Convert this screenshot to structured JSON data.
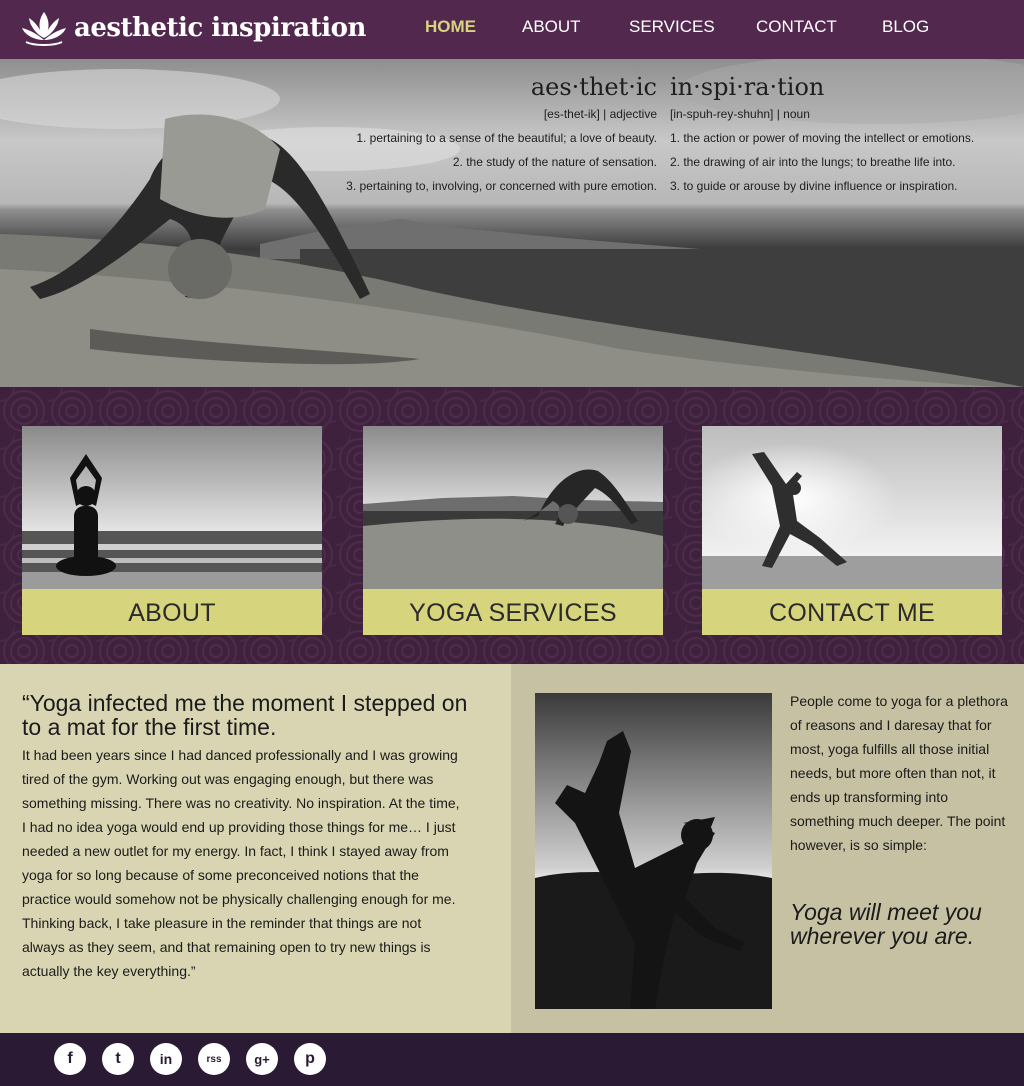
{
  "brand": {
    "name": "aesthetic inspiration",
    "accent": "#d6d47d",
    "purple": "#52284f"
  },
  "nav": [
    {
      "label": "HOME",
      "active": true
    },
    {
      "label": "ABOUT",
      "active": false
    },
    {
      "label": "SERVICES",
      "active": false
    },
    {
      "label": "CONTACT",
      "active": false
    },
    {
      "label": "BLOG",
      "active": false
    }
  ],
  "definition": {
    "left": {
      "word": "aes·thet·ic",
      "pron": "[es-thet-ik]  |  adjective",
      "senses": [
        "1. pertaining to a sense of the beautiful; a love of beauty.",
        "2. the study of the nature of sensation.",
        "3. pertaining to, involving, or concerned with pure emotion."
      ]
    },
    "right": {
      "word": "in·spi·ra·tion",
      "pron": "[in-spuh-rey-shuhn]  |  noun",
      "senses": [
        "1. the action or power of moving the intellect or emotions.",
        "2. the drawing of air into the lungs; to breathe life into.",
        "3. to guide or arouse by divine influence or inspiration."
      ]
    }
  },
  "cards": [
    {
      "label": "ABOUT"
    },
    {
      "label": "YOGA SERVICES"
    },
    {
      "label": "CONTACT ME"
    }
  ],
  "quote": {
    "headline": "“Yoga infected me the moment I stepped on to a mat for the first time.",
    "body": "It had been years since I had danced professionally and I was growing tired of the gym. Working out was engaging enough, but there was something missing. There was no creativity. No inspiration. At the time, I had no idea yoga would end up providing those things for me… I just needed a new outlet for my energy. In fact, I think I stayed away from yoga for so long because of some preconceived notions that the practice would somehow not be physically challenging enough for me. Thinking back, I take pleasure in the reminder that things are not always as they seem, and that remaining open to try new things is actually the key everything.”"
  },
  "aside": {
    "text": "People come to yoga for a plethora of reasons and I daresay that for most, yoga fulfills all those initial needs, but more often than not, it ends up transforming into something much deeper. The point however, is so simple:",
    "emphasis": "Yoga will meet you wherever you are."
  },
  "social": [
    {
      "icon": "facebook-icon",
      "glyph": "f"
    },
    {
      "icon": "twitter-icon",
      "glyph": "t"
    },
    {
      "icon": "linkedin-icon",
      "glyph": "in"
    },
    {
      "icon": "rss-icon",
      "glyph": "rss"
    },
    {
      "icon": "google-plus-icon",
      "glyph": "g+"
    },
    {
      "icon": "pinterest-icon",
      "glyph": "p"
    }
  ]
}
